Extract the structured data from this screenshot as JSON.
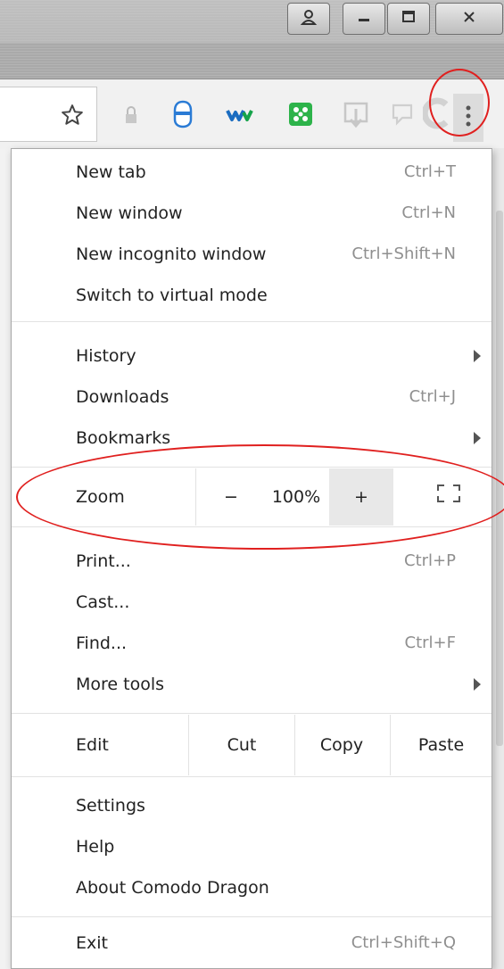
{
  "window": {
    "buttons": [
      {
        "name": "user-button",
        "glyph": "👤"
      },
      {
        "name": "minimize-button",
        "glyph": "▁"
      },
      {
        "name": "maximize-button",
        "glyph": "▣"
      },
      {
        "name": "close-button",
        "glyph": "X"
      }
    ]
  },
  "toolbar": {
    "icons": [
      "bookmark-star-icon",
      "lock-icon",
      "shield-icon",
      "wave-logo-icon",
      "green-dice-icon",
      "download-icon",
      "chat-icon",
      "c-logo-icon",
      "menu-kebab-icon"
    ]
  },
  "menu": {
    "group1": [
      {
        "label": "New tab",
        "shortcut": "Ctrl+T"
      },
      {
        "label": "New window",
        "shortcut": "Ctrl+N"
      },
      {
        "label": "New incognito window",
        "shortcut": "Ctrl+Shift+N"
      },
      {
        "label": "Switch to virtual mode",
        "shortcut": ""
      }
    ],
    "group2": [
      {
        "label": "History",
        "shortcut": ""
      },
      {
        "label": "Downloads",
        "shortcut": "Ctrl+J"
      },
      {
        "label": "Bookmarks",
        "shortcut": ""
      }
    ],
    "zoom": {
      "label": "Zoom",
      "minus": "−",
      "value": "100%",
      "plus": "+"
    },
    "group3": [
      {
        "label": "Print...",
        "shortcut": "Ctrl+P"
      },
      {
        "label": "Cast...",
        "shortcut": ""
      },
      {
        "label": "Find...",
        "shortcut": "Ctrl+F"
      },
      {
        "label": "More tools",
        "shortcut": ""
      }
    ],
    "edit": {
      "label": "Edit",
      "cut": "Cut",
      "copy": "Copy",
      "paste": "Paste"
    },
    "group4": [
      {
        "label": "Settings"
      },
      {
        "label": "Help"
      },
      {
        "label": "About Comodo Dragon"
      }
    ],
    "exit": {
      "label": "Exit",
      "shortcut": "Ctrl+Shift+Q"
    }
  },
  "colors": {
    "highlight": "#e0201f",
    "hover": "#e8e8e8",
    "accent_green": "#2db34a",
    "accent_blue": "#2a7bd5"
  }
}
